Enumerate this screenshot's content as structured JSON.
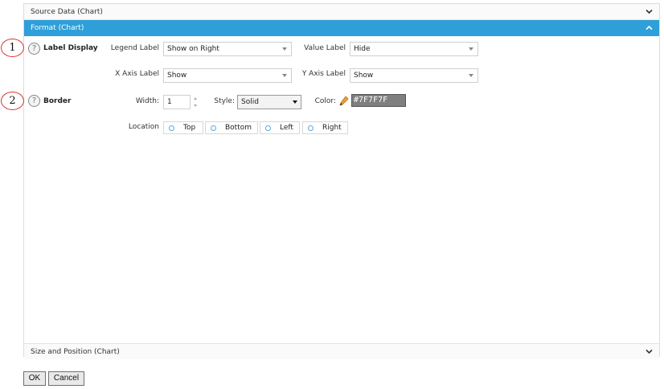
{
  "accordion": {
    "source_data": "Source Data (Chart)",
    "format": "Format (Chart)",
    "size_position": "Size and Position (Chart)"
  },
  "callouts": {
    "one": "1",
    "two": "2"
  },
  "label_display": {
    "title": "Label Display",
    "legend_label": "Legend Label",
    "legend_value": "Show on Right",
    "value_label": "Value Label",
    "value_value": "Hide",
    "x_axis_label": "X Axis Label",
    "x_axis_value": "Show",
    "y_axis_label": "Y Axis Label",
    "y_axis_value": "Show"
  },
  "border": {
    "title": "Border",
    "width_label": "Width:",
    "width_value": "1",
    "style_label": "Style:",
    "style_value": "Solid",
    "color_label": "Color:",
    "color_value": "#7F7F7F",
    "location_label": "Location",
    "locations": [
      "Top",
      "Bottom",
      "Left",
      "Right"
    ]
  },
  "help_glyph": "?",
  "buttons": {
    "ok": "OK",
    "cancel": "Cancel"
  },
  "colors": {
    "accent": "#2e9fd8",
    "border_color": "#7F7F7F",
    "callout": "#dd3333"
  },
  "icons": {
    "expand": "chevron-down-icon",
    "collapse": "chevron-up-icon",
    "help": "help-icon",
    "color_picker": "pencil-icon"
  }
}
